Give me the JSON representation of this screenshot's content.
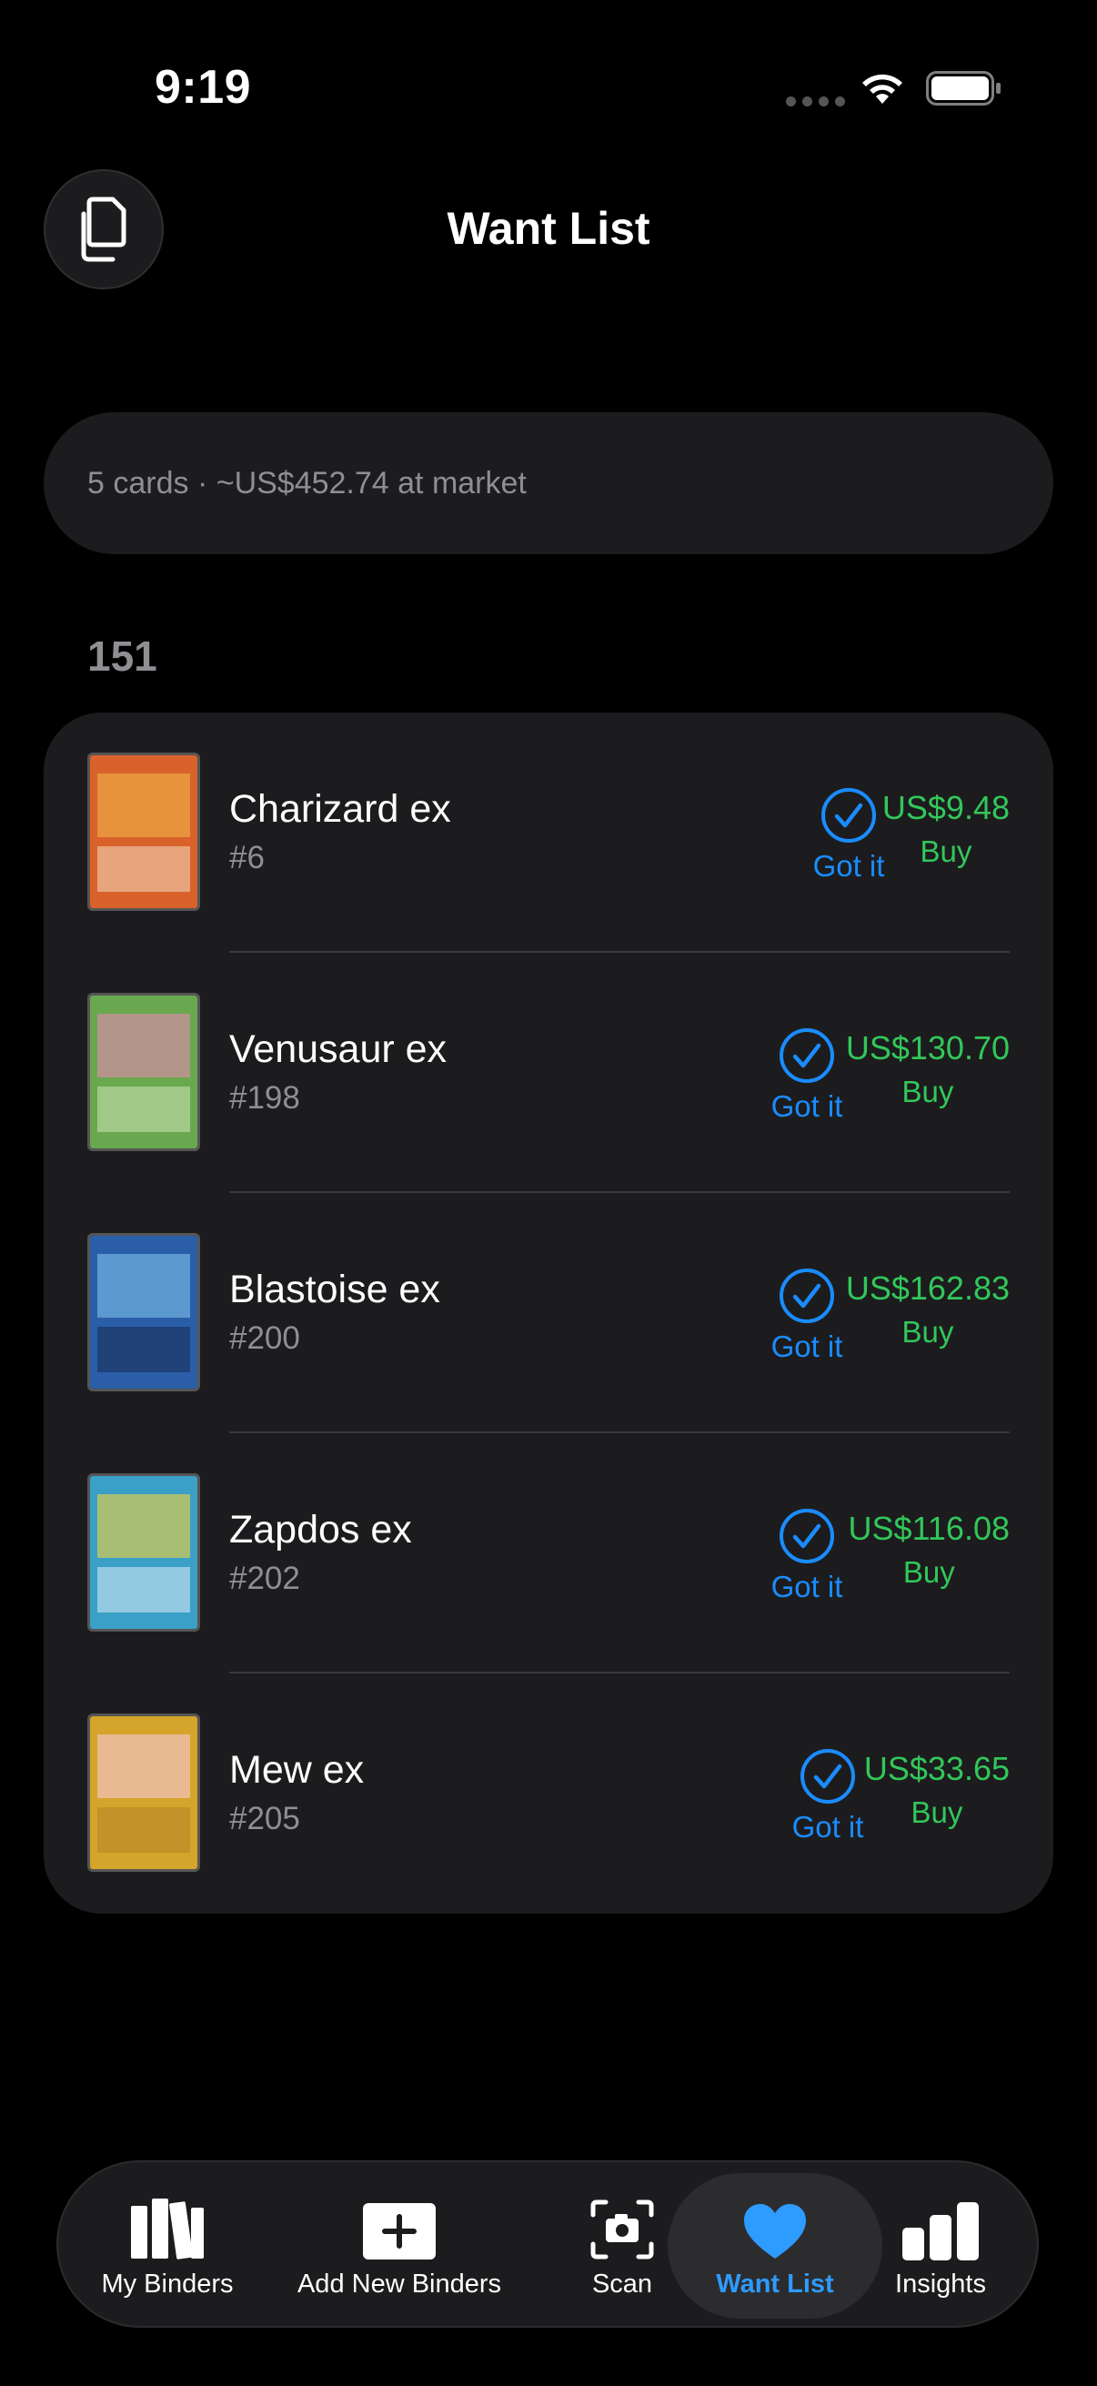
{
  "status_bar": {
    "time": "9:19"
  },
  "header": {
    "title": "Want List",
    "left_icon": "copy-icon"
  },
  "summary": {
    "text": "5 cards · ~US$452.74 at market"
  },
  "section": {
    "title": "151"
  },
  "cards": [
    {
      "name": "Charizard ex",
      "number": "#6",
      "got_label": "Got it",
      "price": "US$9.48",
      "buy_label": "Buy",
      "art_color": "#d9622b"
    },
    {
      "name": "Venusaur ex",
      "number": "#198",
      "got_label": "Got it",
      "price": "US$130.70",
      "buy_label": "Buy",
      "art_color": "#6aa84f"
    },
    {
      "name": "Blastoise ex",
      "number": "#200",
      "got_label": "Got it",
      "price": "US$162.83",
      "buy_label": "Buy",
      "art_color": "#2a5fa8"
    },
    {
      "name": "Zapdos ex",
      "number": "#202",
      "got_label": "Got it",
      "price": "US$116.08",
      "buy_label": "Buy",
      "art_color": "#3aa0c8"
    },
    {
      "name": "Mew ex",
      "number": "#205",
      "got_label": "Got it",
      "price": "US$33.65",
      "buy_label": "Buy",
      "art_color": "#d4a52a"
    }
  ],
  "tabs": [
    {
      "label": "My Binders",
      "icon": "binders-icon"
    },
    {
      "label": "Add New Binders",
      "icon": "plus-box-icon"
    },
    {
      "label": "Scan",
      "icon": "camera-scan-icon"
    },
    {
      "label": "Want List",
      "icon": "heart-icon",
      "active": true
    },
    {
      "label": "Insights",
      "icon": "bar-chart-icon"
    }
  ],
  "colors": {
    "accent_blue": "#1a8cff",
    "price_green": "#32c75a",
    "surface": "#1c1c1e"
  }
}
